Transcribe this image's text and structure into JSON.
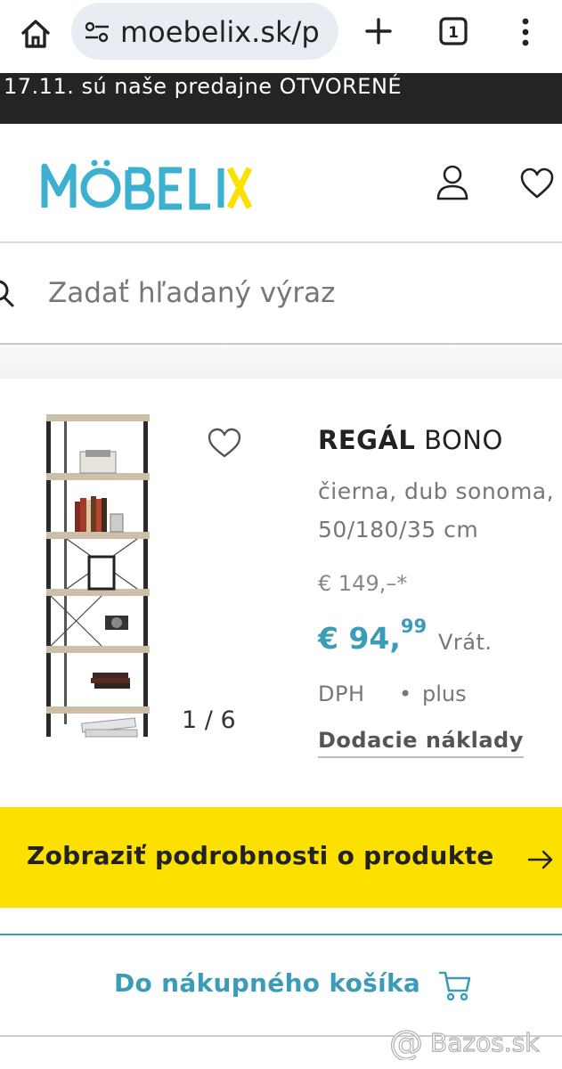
{
  "browser": {
    "url": "moebelix.sk/p",
    "tab_count": "1"
  },
  "announcement": {
    "text": "17.11. sú naše predajne OTVORENÉ"
  },
  "header": {
    "logo_text": "MÖBELIX",
    "colors": {
      "logo_blue": "#3bb0cf",
      "logo_yellow": "#fce100"
    }
  },
  "search": {
    "placeholder": "Zadať hľadaný výraz"
  },
  "product": {
    "image_counter": "1 / 6",
    "title_bold": "REGÁL",
    "title_rest": " BONO",
    "description_line1": "čierna, dub sonoma,",
    "description_line2": "50/180/35 cm",
    "old_price": "€ 149,–*",
    "price_main": "€ 94,",
    "price_cents": "99",
    "vat_line1": "Vrát.",
    "vat_line2": "DPH",
    "vat_separator": "•",
    "shipping_prefix": "plus",
    "shipping_link": "Dodacie náklady"
  },
  "actions": {
    "details_label": "Zobraziť podrobnosti o produkte",
    "cart_label": "Do nákupného košíka"
  },
  "watermark": {
    "text": "Bazos.sk"
  },
  "colors": {
    "accent_blue": "#3b9cb8",
    "cta_yellow": "#fce100",
    "announcement_bg": "#222426"
  }
}
